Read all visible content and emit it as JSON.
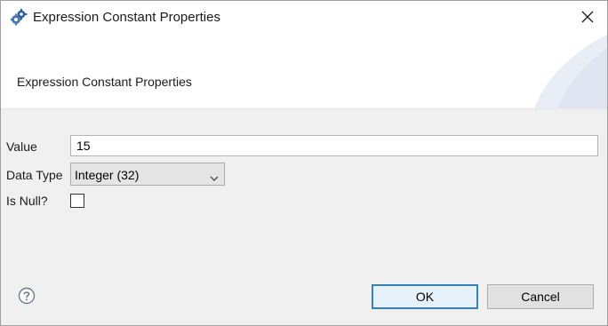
{
  "window": {
    "title": "Expression Constant Properties",
    "icon": "gears-icon",
    "close_icon": "close-icon"
  },
  "banner": {
    "title": "Expression Constant Properties"
  },
  "form": {
    "value_label": "Value",
    "value": "15",
    "data_type_label": "Data Type",
    "data_type_selected": "Integer (32)",
    "is_null_label": "Is Null?",
    "is_null_checked": false
  },
  "footer": {
    "help_icon": "help-icon",
    "ok_label": "OK",
    "cancel_label": "Cancel"
  },
  "colors": {
    "default_button_border": "#3c7fb1",
    "background": "#f0f0f0"
  }
}
